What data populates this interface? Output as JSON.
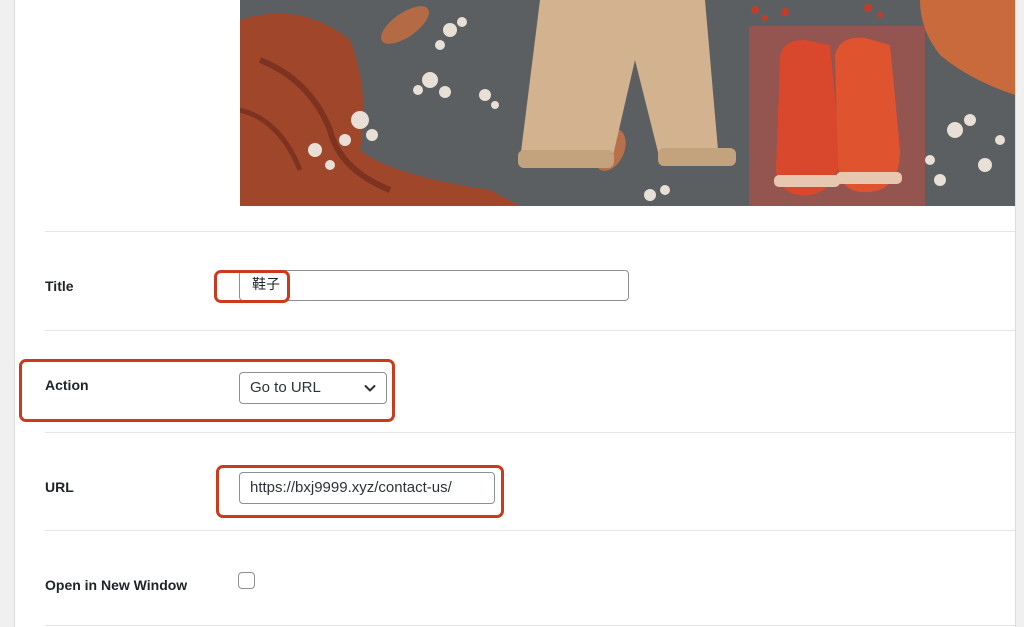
{
  "product_image": {
    "description_icon": "photo-thumbnail",
    "highlight_color": "#d9473a"
  },
  "form": {
    "title": {
      "label": "Title",
      "value": "鞋子"
    },
    "action": {
      "label": "Action",
      "selected": "Go to URL"
    },
    "url": {
      "label": "URL",
      "value": "https://bxj9999.xyz/contact-us/"
    },
    "new_window": {
      "label": "Open in New Window",
      "checked": false
    }
  },
  "colors": {
    "annotation_border": "#cc3a1e",
    "input_border": "#8c8f94"
  }
}
